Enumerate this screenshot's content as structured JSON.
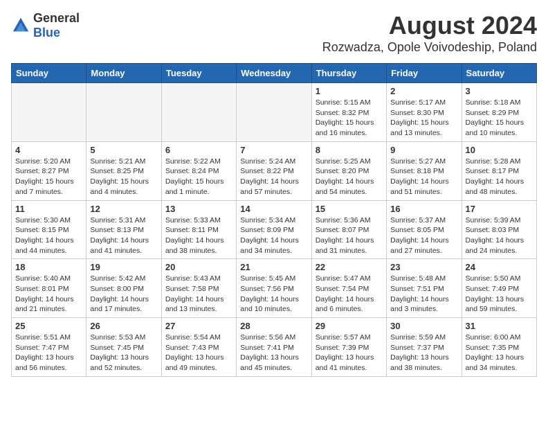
{
  "header": {
    "logo_general": "General",
    "logo_blue": "Blue",
    "main_title": "August 2024",
    "subtitle": "Rozwadza, Opole Voivodeship, Poland"
  },
  "weekdays": [
    "Sunday",
    "Monday",
    "Tuesday",
    "Wednesday",
    "Thursday",
    "Friday",
    "Saturday"
  ],
  "weeks": [
    [
      {
        "day": "",
        "info": ""
      },
      {
        "day": "",
        "info": ""
      },
      {
        "day": "",
        "info": ""
      },
      {
        "day": "",
        "info": ""
      },
      {
        "day": "1",
        "info": "Sunrise: 5:15 AM\nSunset: 8:32 PM\nDaylight: 15 hours\nand 16 minutes."
      },
      {
        "day": "2",
        "info": "Sunrise: 5:17 AM\nSunset: 8:30 PM\nDaylight: 15 hours\nand 13 minutes."
      },
      {
        "day": "3",
        "info": "Sunrise: 5:18 AM\nSunset: 8:29 PM\nDaylight: 15 hours\nand 10 minutes."
      }
    ],
    [
      {
        "day": "4",
        "info": "Sunrise: 5:20 AM\nSunset: 8:27 PM\nDaylight: 15 hours\nand 7 minutes."
      },
      {
        "day": "5",
        "info": "Sunrise: 5:21 AM\nSunset: 8:25 PM\nDaylight: 15 hours\nand 4 minutes."
      },
      {
        "day": "6",
        "info": "Sunrise: 5:22 AM\nSunset: 8:24 PM\nDaylight: 15 hours\nand 1 minute."
      },
      {
        "day": "7",
        "info": "Sunrise: 5:24 AM\nSunset: 8:22 PM\nDaylight: 14 hours\nand 57 minutes."
      },
      {
        "day": "8",
        "info": "Sunrise: 5:25 AM\nSunset: 8:20 PM\nDaylight: 14 hours\nand 54 minutes."
      },
      {
        "day": "9",
        "info": "Sunrise: 5:27 AM\nSunset: 8:18 PM\nDaylight: 14 hours\nand 51 minutes."
      },
      {
        "day": "10",
        "info": "Sunrise: 5:28 AM\nSunset: 8:17 PM\nDaylight: 14 hours\nand 48 minutes."
      }
    ],
    [
      {
        "day": "11",
        "info": "Sunrise: 5:30 AM\nSunset: 8:15 PM\nDaylight: 14 hours\nand 44 minutes."
      },
      {
        "day": "12",
        "info": "Sunrise: 5:31 AM\nSunset: 8:13 PM\nDaylight: 14 hours\nand 41 minutes."
      },
      {
        "day": "13",
        "info": "Sunrise: 5:33 AM\nSunset: 8:11 PM\nDaylight: 14 hours\nand 38 minutes."
      },
      {
        "day": "14",
        "info": "Sunrise: 5:34 AM\nSunset: 8:09 PM\nDaylight: 14 hours\nand 34 minutes."
      },
      {
        "day": "15",
        "info": "Sunrise: 5:36 AM\nSunset: 8:07 PM\nDaylight: 14 hours\nand 31 minutes."
      },
      {
        "day": "16",
        "info": "Sunrise: 5:37 AM\nSunset: 8:05 PM\nDaylight: 14 hours\nand 27 minutes."
      },
      {
        "day": "17",
        "info": "Sunrise: 5:39 AM\nSunset: 8:03 PM\nDaylight: 14 hours\nand 24 minutes."
      }
    ],
    [
      {
        "day": "18",
        "info": "Sunrise: 5:40 AM\nSunset: 8:01 PM\nDaylight: 14 hours\nand 21 minutes."
      },
      {
        "day": "19",
        "info": "Sunrise: 5:42 AM\nSunset: 8:00 PM\nDaylight: 14 hours\nand 17 minutes."
      },
      {
        "day": "20",
        "info": "Sunrise: 5:43 AM\nSunset: 7:58 PM\nDaylight: 14 hours\nand 13 minutes."
      },
      {
        "day": "21",
        "info": "Sunrise: 5:45 AM\nSunset: 7:56 PM\nDaylight: 14 hours\nand 10 minutes."
      },
      {
        "day": "22",
        "info": "Sunrise: 5:47 AM\nSunset: 7:54 PM\nDaylight: 14 hours\nand 6 minutes."
      },
      {
        "day": "23",
        "info": "Sunrise: 5:48 AM\nSunset: 7:51 PM\nDaylight: 14 hours\nand 3 minutes."
      },
      {
        "day": "24",
        "info": "Sunrise: 5:50 AM\nSunset: 7:49 PM\nDaylight: 13 hours\nand 59 minutes."
      }
    ],
    [
      {
        "day": "25",
        "info": "Sunrise: 5:51 AM\nSunset: 7:47 PM\nDaylight: 13 hours\nand 56 minutes."
      },
      {
        "day": "26",
        "info": "Sunrise: 5:53 AM\nSunset: 7:45 PM\nDaylight: 13 hours\nand 52 minutes."
      },
      {
        "day": "27",
        "info": "Sunrise: 5:54 AM\nSunset: 7:43 PM\nDaylight: 13 hours\nand 49 minutes."
      },
      {
        "day": "28",
        "info": "Sunrise: 5:56 AM\nSunset: 7:41 PM\nDaylight: 13 hours\nand 45 minutes."
      },
      {
        "day": "29",
        "info": "Sunrise: 5:57 AM\nSunset: 7:39 PM\nDaylight: 13 hours\nand 41 minutes."
      },
      {
        "day": "30",
        "info": "Sunrise: 5:59 AM\nSunset: 7:37 PM\nDaylight: 13 hours\nand 38 minutes."
      },
      {
        "day": "31",
        "info": "Sunrise: 6:00 AM\nSunset: 7:35 PM\nDaylight: 13 hours\nand 34 minutes."
      }
    ]
  ]
}
